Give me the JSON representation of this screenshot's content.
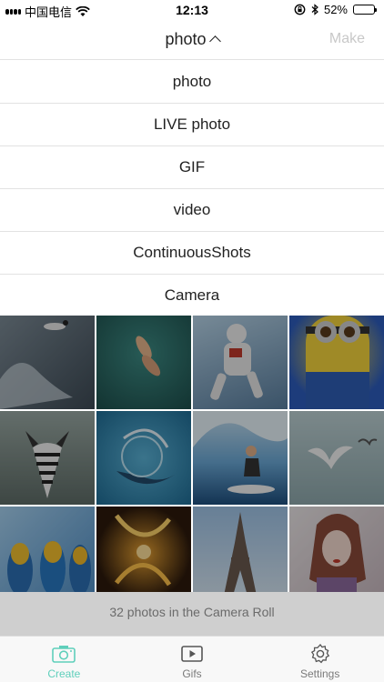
{
  "status_bar": {
    "carrier": "中国电信",
    "time": "12:13",
    "battery_percent": "52%",
    "battery_level": 0.52
  },
  "nav": {
    "title": "photo",
    "make_label": "Make"
  },
  "menu": {
    "items": [
      {
        "label": "photo"
      },
      {
        "label": "LIVE photo"
      },
      {
        "label": "GIF"
      },
      {
        "label": "video"
      },
      {
        "label": "ContinuousShots"
      },
      {
        "label": "Camera"
      }
    ]
  },
  "grid": {
    "photos": [
      {
        "subject": "skydiver"
      },
      {
        "subject": "swimmers"
      },
      {
        "subject": "astronaut"
      },
      {
        "subject": "minion"
      },
      {
        "subject": "zebra"
      },
      {
        "subject": "whale"
      },
      {
        "subject": "surfer"
      },
      {
        "subject": "birds"
      },
      {
        "subject": "parrots"
      },
      {
        "subject": "light-painting"
      },
      {
        "subject": "eiffel-tower"
      },
      {
        "subject": "portrait"
      }
    ]
  },
  "footer": {
    "count_text": "32 photos in the Camera Roll"
  },
  "tabbar": {
    "tabs": [
      {
        "label": "Create",
        "icon": "camera-icon",
        "active": true
      },
      {
        "label": "Gifs",
        "icon": "play-icon",
        "active": false
      },
      {
        "label": "Settings",
        "icon": "gear-icon",
        "active": false
      }
    ]
  },
  "colors": {
    "accent": "#5fcfbb",
    "footer_bg": "#cfcfcf",
    "divider": "#e2e2e2"
  }
}
